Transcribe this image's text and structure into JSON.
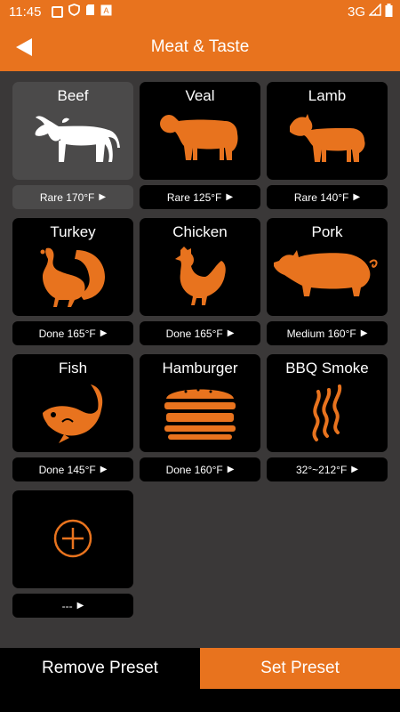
{
  "status": {
    "time": "11:45",
    "network": "3G"
  },
  "header": {
    "title": "Meat & Taste"
  },
  "presets": [
    {
      "name": "Beef",
      "value": "Rare 170°F",
      "icon": "cow-icon",
      "selected": true
    },
    {
      "name": "Veal",
      "value": "Rare 125°F",
      "icon": "calf-icon"
    },
    {
      "name": "Lamb",
      "value": "Rare 140°F",
      "icon": "lamb-icon"
    },
    {
      "name": "Turkey",
      "value": "Done 165°F",
      "icon": "turkey-icon"
    },
    {
      "name": "Chicken",
      "value": "Done 165°F",
      "icon": "chicken-icon"
    },
    {
      "name": "Pork",
      "value": "Medium 160°F",
      "icon": "pig-icon"
    },
    {
      "name": "Fish",
      "value": "Done 145°F",
      "icon": "fish-icon"
    },
    {
      "name": "Hamburger",
      "value": "Done 160°F",
      "icon": "hamburger-icon"
    },
    {
      "name": "BBQ Smoke",
      "value": "32°~212°F",
      "icon": "smoke-icon"
    },
    {
      "name": "",
      "value": "---",
      "icon": "add-circle-icon"
    }
  ],
  "footer": {
    "remove_label": "Remove Preset",
    "set_label": "Set Preset"
  },
  "colors": {
    "accent": "#e8731e",
    "background": "#3a3838",
    "card": "#000000",
    "selected_card": "#4b4a4a"
  }
}
